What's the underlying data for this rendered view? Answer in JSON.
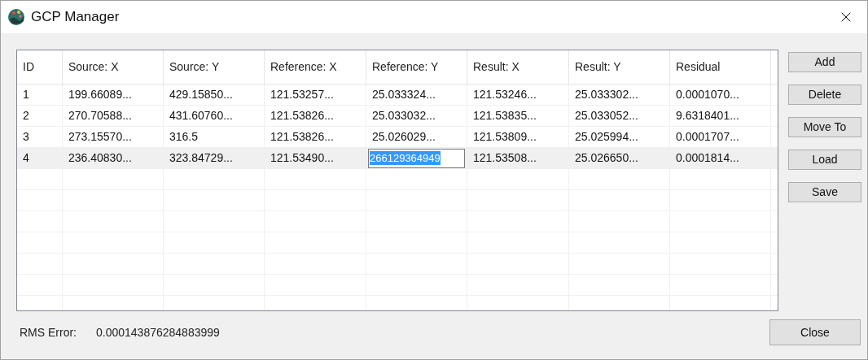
{
  "window": {
    "title": "GCP Manager"
  },
  "table": {
    "columns": [
      "ID",
      "Source: X",
      "Source: Y",
      "Reference: X",
      "Reference: Y",
      "Result: X",
      "Result: Y",
      "Residual"
    ],
    "rows": [
      {
        "selected": false,
        "cells": [
          {
            "text": "1",
            "editing": false
          },
          {
            "text": "199.66089...",
            "editing": false
          },
          {
            "text": "429.15850...",
            "editing": false
          },
          {
            "text": "121.53257...",
            "editing": false
          },
          {
            "text": "25.033324...",
            "editing": false
          },
          {
            "text": "121.53246...",
            "editing": false
          },
          {
            "text": "25.033302...",
            "editing": false
          },
          {
            "text": "0.0001070...",
            "editing": false
          }
        ]
      },
      {
        "selected": false,
        "cells": [
          {
            "text": "2",
            "editing": false
          },
          {
            "text": "270.70588...",
            "editing": false
          },
          {
            "text": "431.60760...",
            "editing": false
          },
          {
            "text": "121.53826...",
            "editing": false
          },
          {
            "text": "25.033032...",
            "editing": false
          },
          {
            "text": "121.53835...",
            "editing": false
          },
          {
            "text": "25.033052...",
            "editing": false
          },
          {
            "text": "9.6318401...",
            "editing": false
          }
        ]
      },
      {
        "selected": false,
        "cells": [
          {
            "text": "3",
            "editing": false
          },
          {
            "text": "273.15570...",
            "editing": false
          },
          {
            "text": "316.5",
            "editing": false
          },
          {
            "text": "121.53826...",
            "editing": false
          },
          {
            "text": "25.026029...",
            "editing": false
          },
          {
            "text": "121.53809...",
            "editing": false
          },
          {
            "text": "25.025994...",
            "editing": false
          },
          {
            "text": "0.0001707...",
            "editing": false
          }
        ]
      },
      {
        "selected": true,
        "cells": [
          {
            "text": "4",
            "editing": false
          },
          {
            "text": "236.40830...",
            "editing": false
          },
          {
            "text": "323.84729...",
            "editing": false
          },
          {
            "text": "121.53490...",
            "editing": false
          },
          {
            "text": "266129364949",
            "editing": true
          },
          {
            "text": "121.53508...",
            "editing": false
          },
          {
            "text": "25.026650...",
            "editing": false
          },
          {
            "text": "0.0001814...",
            "editing": false
          }
        ]
      }
    ]
  },
  "side_buttons": [
    "Add",
    "Delete",
    "Move To",
    "Load",
    "Save"
  ],
  "rms": {
    "label": "RMS Error:",
    "value": "0.000143876284883999"
  },
  "close_button": "Close"
}
